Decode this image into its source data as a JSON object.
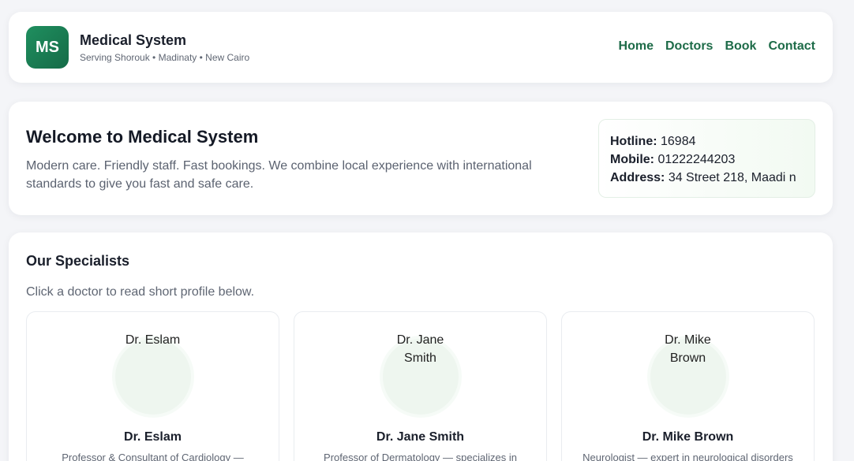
{
  "header": {
    "logo_text": "MS",
    "title": "Medical System",
    "subtitle": "Serving Shorouk • Madinaty • New Cairo",
    "nav": [
      {
        "label": "Home"
      },
      {
        "label": "Doctors"
      },
      {
        "label": "Book"
      },
      {
        "label": "Contact"
      }
    ]
  },
  "welcome": {
    "title": "Welcome to Medical System",
    "text": "Modern care. Friendly staff. Fast bookings. We combine local experience with international standards to give you fast and safe care.",
    "info": {
      "hotline_label": "Hotline:",
      "hotline_value": "16984",
      "mobile_label": "Mobile:",
      "mobile_value": "01222244203",
      "address_label": "Address:",
      "address_value": "34 Street 218, Maadi n"
    }
  },
  "specialists": {
    "title": "Our Specialists",
    "lead": "Click a doctor to read short profile below.",
    "doctors": [
      {
        "alt": "Dr. Eslam",
        "name": "Dr. Eslam",
        "desc": "Professor & Consultant of Cardiology —"
      },
      {
        "alt": "Dr. Jane Smith",
        "name": "Dr. Jane Smith",
        "desc": "Professor of Dermatology — specializes in"
      },
      {
        "alt": "Dr. Mike Brown",
        "name": "Dr. Mike Brown",
        "desc": "Neurologist — expert in neurological disorders"
      }
    ]
  },
  "colors": {
    "brand_green": "#1d6b48",
    "logo_gradient_start": "#1f8f5f",
    "logo_gradient_end": "#156b47",
    "page_background": "#f4f5f8"
  }
}
